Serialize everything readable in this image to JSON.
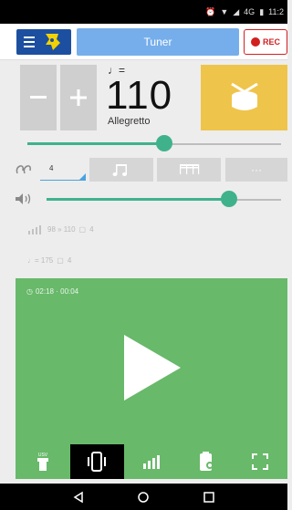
{
  "status_bar": {
    "signal_label": "4G",
    "time": "11:2"
  },
  "header": {
    "tab_label": "Tuner",
    "rec_label": "REC"
  },
  "tempo": {
    "note_symbol": "♩=",
    "bpm": "110",
    "name": "Allegretto",
    "slider_fraction": 0.54
  },
  "beats": {
    "value": "4",
    "volume_fraction": 0.78
  },
  "trainer": {
    "range_text": "98 » 110",
    "beats_text": "4"
  },
  "timer_preset": {
    "text": "♩= 175",
    "beats_text": "4"
  },
  "play_panel": {
    "timer_text": "02:18 · 00:04",
    "color": "#68b96a"
  },
  "bottom_tabs": [
    {
      "name": "flash",
      "label": "USV"
    },
    {
      "name": "vibrate"
    },
    {
      "name": "trainer"
    },
    {
      "name": "presets"
    },
    {
      "name": "fullscreen"
    }
  ],
  "colors": {
    "accent_blue": "#1c4fa0",
    "tab_blue": "#76aeeb",
    "rec_red": "#d21f1f",
    "drum_yellow": "#efc44a",
    "slider_green": "#3fb28c"
  }
}
